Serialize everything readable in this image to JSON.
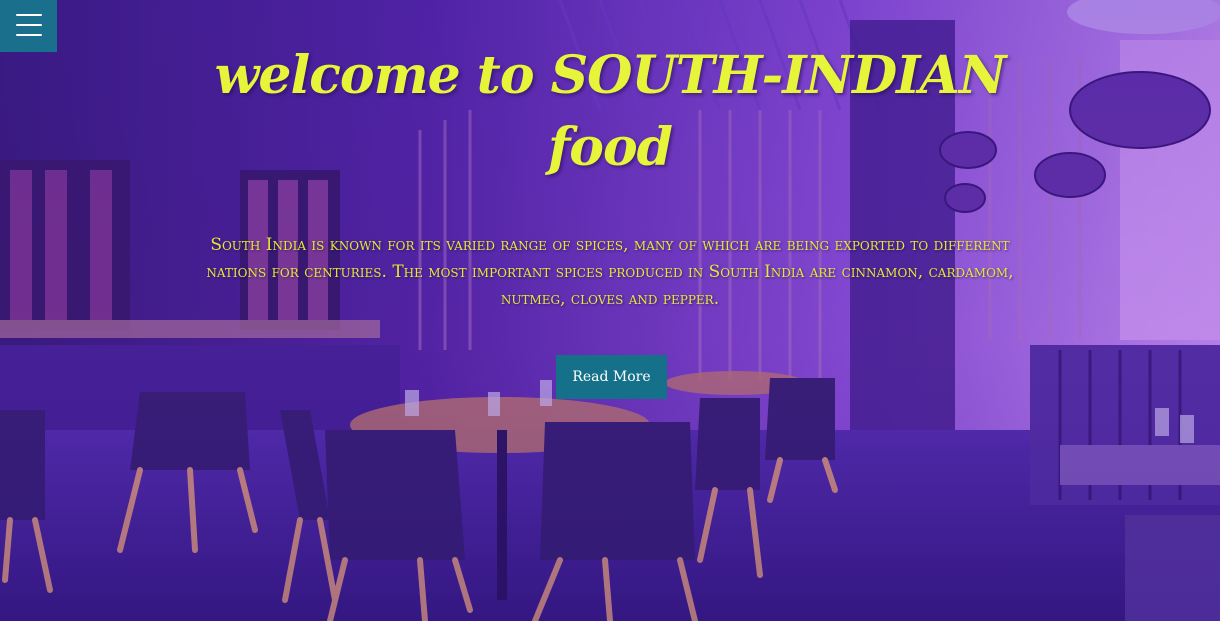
{
  "nav": {
    "menu_icon": "hamburger-menu-icon"
  },
  "hero": {
    "title": "welcome to SOUTH-INDIAN food",
    "description": "South India is known for its varied range of spices, many of which are being exported to different nations for centuries. The most important spices produced in South India are cinnamon, cardamom, nutmeg, cloves and pepper.",
    "button_label": "Read More"
  },
  "colors": {
    "title": "#e6f53a",
    "text": "#e3e838",
    "button": "#157089",
    "menu_button": "#1a6f8c",
    "overlay": "#5c28c8"
  }
}
